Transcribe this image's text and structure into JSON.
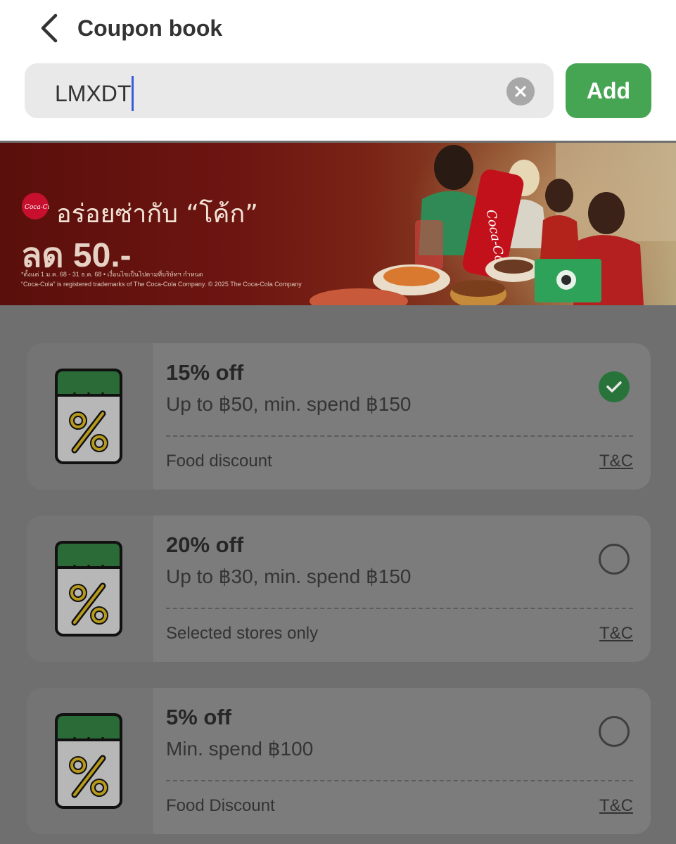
{
  "header": {
    "back_icon": "chevron-left-icon",
    "title": "Coupon book"
  },
  "search": {
    "value": "LMXDT",
    "clear_icon": "close-circle-icon",
    "add_label": "Add"
  },
  "banner": {
    "brand": "Coca-Cola",
    "headline": "อร่อยซ่ากับ “โค้ก”",
    "price": "ลด 50.-",
    "fine_print_1": "*ตั้งแต่ 1 ม.ค. 68 - 31 ธ.ค. 68 • เงื่อนไขเป็นไปตามที่บริษัทฯ กำหนด",
    "fine_print_2": "“Coca-Cola” is registered trademarks of The Coca-Cola Company. © 2025 The Coca-Cola Company"
  },
  "coupons": [
    {
      "title": "15% off",
      "subtitle": "Up to ฿50, min. spend ฿150",
      "tag": "Food discount",
      "tc": "T&C",
      "selected": true
    },
    {
      "title": "20% off",
      "subtitle": "Up to ฿30, min. spend ฿150",
      "tag": "Selected stores only",
      "tc": "T&C",
      "selected": false
    },
    {
      "title": "5% off",
      "subtitle": "Min. spend ฿100",
      "tag": "Food Discount",
      "tc": "T&C",
      "selected": false
    }
  ],
  "colors": {
    "accent_green": "#45a552",
    "selected_green": "#27733a",
    "caret_blue": "#3b5bdb",
    "overlay": "#6f6f6f"
  }
}
